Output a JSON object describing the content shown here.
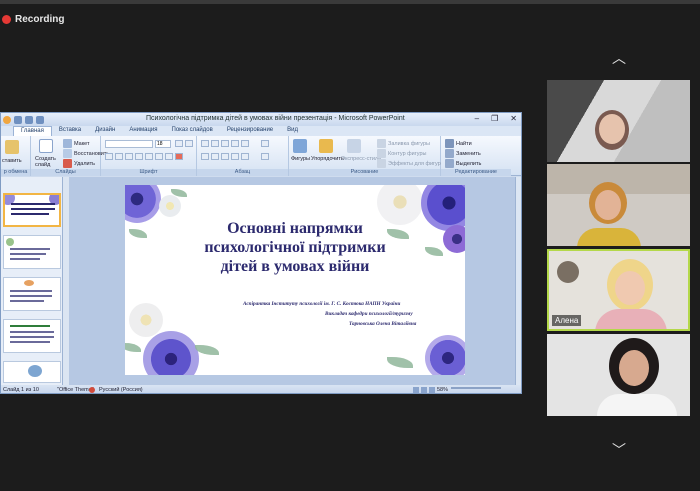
{
  "recording": {
    "label": "Recording"
  },
  "powerpoint": {
    "window_title": "Психологічна підтримка дітей в умовах війни презентація - Microsoft PowerPoint",
    "tabs": [
      "Главная",
      "Вставка",
      "Дизайн",
      "Анимация",
      "Показ слайдов",
      "Рецензирование",
      "Вид"
    ],
    "ribbon": {
      "insert_label": "ставить",
      "clipboard_label": "р обмена",
      "create_slide": "Создать слайд",
      "layout": "Макет",
      "restore": "Восстановить",
      "delete": "Удалить",
      "slides_label": "Слайды",
      "font_size": "18",
      "font_label": "Шрифт",
      "paragraph_label": "Абзац",
      "shapes": "Фигуры",
      "arrange": "Упорядочить",
      "quick_styles": "Экспресс-стили",
      "fill": "Заливка фигуры",
      "outline": "Контур фигуры",
      "effects": "Эффекты для фигур",
      "drawing_label": "Рисование",
      "find": "Найти",
      "replace": "Заменить",
      "select": "Выделить",
      "editing_label": "Редактирование"
    },
    "slide": {
      "title_lines": [
        "Основні напрямки",
        "психологічної підтримки",
        "дітей в умовах війни"
      ],
      "author_lines": [
        "Аспірантка Інституту психології ім. Г. С. Костюка НАПН України",
        "Викладач кафедри психології/туризму",
        "Тарновська Олена Віталіївна"
      ]
    },
    "status": {
      "slide_counter": "Слайд 1 из 10",
      "theme": "\"Office Theme\"",
      "language": "Русский (Россия)",
      "zoom": "58%"
    }
  },
  "participants": [
    {
      "name": ""
    },
    {
      "name": ""
    },
    {
      "name": "Алена"
    },
    {
      "name": ""
    }
  ],
  "colors": {
    "accent_border": "#b4d84a",
    "record_dot": "#e53935"
  }
}
